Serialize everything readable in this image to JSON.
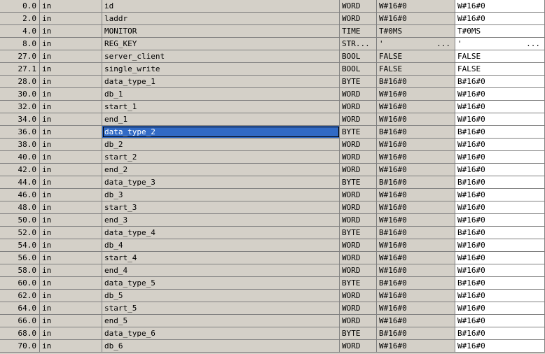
{
  "colors": {
    "grid_bg": "#d4d0c8",
    "grid_line": "#808080",
    "selection": "#316ac5",
    "actual_bg": "#ffffff"
  },
  "rows": [
    {
      "address": "0.0",
      "decl": "in",
      "name": "id",
      "type": "WORD",
      "initial": "W#16#0",
      "actual": "W#16#0"
    },
    {
      "address": "2.0",
      "decl": "in",
      "name": "laddr",
      "type": "WORD",
      "initial": "W#16#0",
      "actual": "W#16#0"
    },
    {
      "address": "4.0",
      "decl": "in",
      "name": "MONITOR",
      "type": "TIME",
      "initial": "T#0MS",
      "actual": "T#0MS"
    },
    {
      "address": "8.0",
      "decl": "in",
      "name": "REG_KEY",
      "type": "STR...",
      "initial": "'",
      "initial_more": "...",
      "actual": "'",
      "actual_more": "..."
    },
    {
      "address": "27.0",
      "decl": "in",
      "name": "server_client",
      "type": "BOOL",
      "initial": "FALSE",
      "actual": "FALSE"
    },
    {
      "address": "27.1",
      "decl": "in",
      "name": "single_write",
      "type": "BOOL",
      "initial": "FALSE",
      "actual": "FALSE"
    },
    {
      "address": "28.0",
      "decl": "in",
      "name": "data_type_1",
      "type": "BYTE",
      "initial": "B#16#0",
      "actual": "B#16#0"
    },
    {
      "address": "30.0",
      "decl": "in",
      "name": "db_1",
      "type": "WORD",
      "initial": "W#16#0",
      "actual": "W#16#0"
    },
    {
      "address": "32.0",
      "decl": "in",
      "name": "start_1",
      "type": "WORD",
      "initial": "W#16#0",
      "actual": "W#16#0"
    },
    {
      "address": "34.0",
      "decl": "in",
      "name": "end_1",
      "type": "WORD",
      "initial": "W#16#0",
      "actual": "W#16#0"
    },
    {
      "address": "36.0",
      "decl": "in",
      "name": "data_type_2",
      "type": "BYTE",
      "initial": "B#16#0",
      "actual": "B#16#0",
      "selected": true
    },
    {
      "address": "38.0",
      "decl": "in",
      "name": "db_2",
      "type": "WORD",
      "initial": "W#16#0",
      "actual": "W#16#0"
    },
    {
      "address": "40.0",
      "decl": "in",
      "name": "start_2",
      "type": "WORD",
      "initial": "W#16#0",
      "actual": "W#16#0"
    },
    {
      "address": "42.0",
      "decl": "in",
      "name": "end_2",
      "type": "WORD",
      "initial": "W#16#0",
      "actual": "W#16#0"
    },
    {
      "address": "44.0",
      "decl": "in",
      "name": "data_type_3",
      "type": "BYTE",
      "initial": "B#16#0",
      "actual": "B#16#0"
    },
    {
      "address": "46.0",
      "decl": "in",
      "name": "db_3",
      "type": "WORD",
      "initial": "W#16#0",
      "actual": "W#16#0"
    },
    {
      "address": "48.0",
      "decl": "in",
      "name": "start_3",
      "type": "WORD",
      "initial": "W#16#0",
      "actual": "W#16#0"
    },
    {
      "address": "50.0",
      "decl": "in",
      "name": "end_3",
      "type": "WORD",
      "initial": "W#16#0",
      "actual": "W#16#0"
    },
    {
      "address": "52.0",
      "decl": "in",
      "name": "data_type_4",
      "type": "BYTE",
      "initial": "B#16#0",
      "actual": "B#16#0"
    },
    {
      "address": "54.0",
      "decl": "in",
      "name": "db_4",
      "type": "WORD",
      "initial": "W#16#0",
      "actual": "W#16#0"
    },
    {
      "address": "56.0",
      "decl": "in",
      "name": "start_4",
      "type": "WORD",
      "initial": "W#16#0",
      "actual": "W#16#0"
    },
    {
      "address": "58.0",
      "decl": "in",
      "name": "end_4",
      "type": "WORD",
      "initial": "W#16#0",
      "actual": "W#16#0"
    },
    {
      "address": "60.0",
      "decl": "in",
      "name": "data_type_5",
      "type": "BYTE",
      "initial": "B#16#0",
      "actual": "B#16#0"
    },
    {
      "address": "62.0",
      "decl": "in",
      "name": "db_5",
      "type": "WORD",
      "initial": "W#16#0",
      "actual": "W#16#0"
    },
    {
      "address": "64.0",
      "decl": "in",
      "name": "start_5",
      "type": "WORD",
      "initial": "W#16#0",
      "actual": "W#16#0"
    },
    {
      "address": "66.0",
      "decl": "in",
      "name": "end_5",
      "type": "WORD",
      "initial": "W#16#0",
      "actual": "W#16#0"
    },
    {
      "address": "68.0",
      "decl": "in",
      "name": "data_type_6",
      "type": "BYTE",
      "initial": "B#16#0",
      "actual": "B#16#0"
    },
    {
      "address": "70.0",
      "decl": "in",
      "name": "db_6",
      "type": "WORD",
      "initial": "W#16#0",
      "actual": "W#16#0"
    }
  ]
}
